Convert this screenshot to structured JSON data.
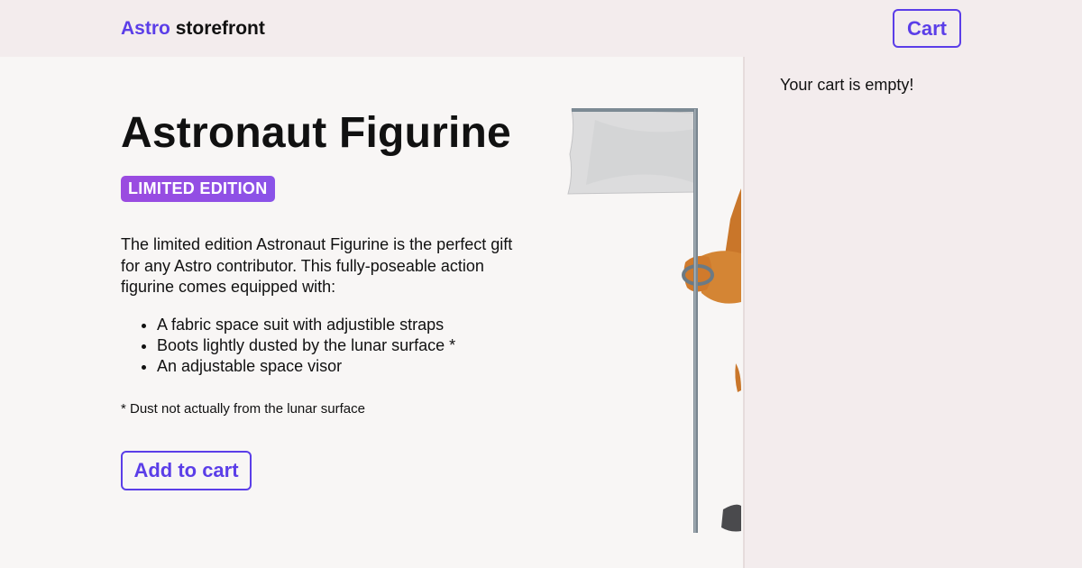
{
  "header": {
    "brand_accent": "Astro",
    "brand_rest": "storefront",
    "cart_label": "Cart"
  },
  "product": {
    "title": "Astronaut Figurine",
    "badge": "LIMITED EDITION",
    "description": "The limited edition Astronaut Figurine is the perfect gift for any Astro contributor. This fully-poseable action figurine comes equipped with:",
    "features": [
      "A fabric space suit with adjustible straps",
      "Boots lightly dusted by the lunar surface *",
      "An adjustable space visor"
    ],
    "footnote": "* Dust not actually from the lunar surface",
    "add_to_cart_label": "Add to cart"
  },
  "cart": {
    "empty_message": "Your cart is empty!"
  },
  "colors": {
    "accent": "#5b3ee8",
    "badge_gradient_start": "#9b4be0",
    "badge_gradient_end": "#8a52e8",
    "header_bg": "#f3eced",
    "page_bg": "#f8f6f5"
  },
  "icons": {
    "product_image": "astronaut-figurine-with-flag"
  }
}
